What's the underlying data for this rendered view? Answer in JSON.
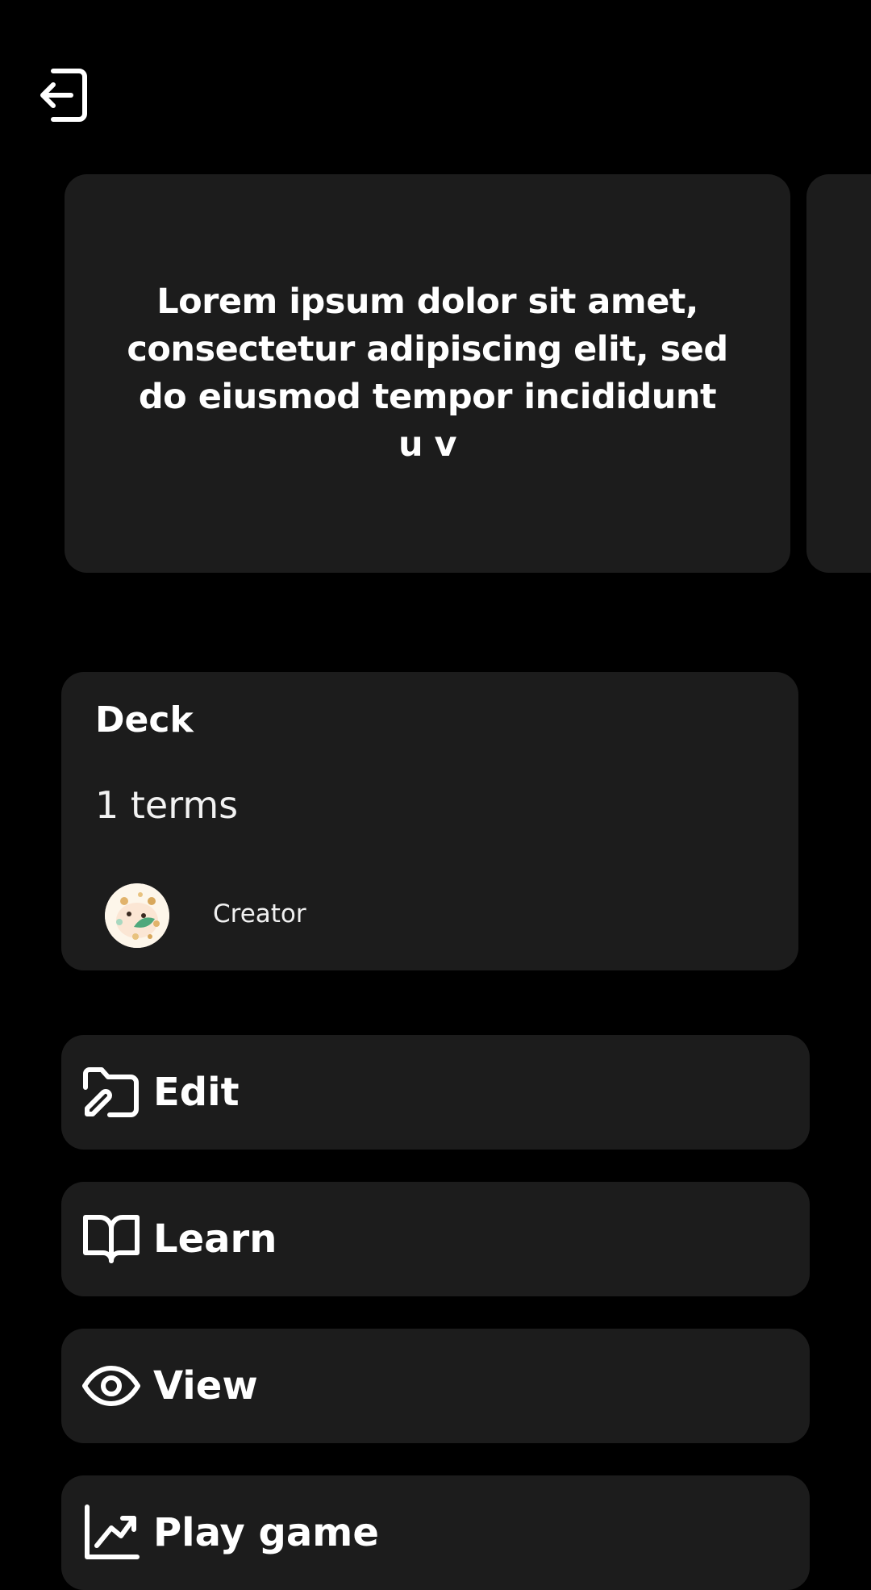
{
  "header": {
    "back_icon": "exit-arrow-icon"
  },
  "flashcard": {
    "front_text": "Lorem ipsum dolor sit amet, consectetur adipiscing elit, sed do eiusmod tempor incididunt u v"
  },
  "deck": {
    "title": "Deck",
    "terms": "1 terms",
    "creator_label": "Creator",
    "avatar_icon": "creator-avatar"
  },
  "actions": [
    {
      "label": "Edit",
      "icon": "folder-edit-icon"
    },
    {
      "label": "Learn",
      "icon": "open-book-icon"
    },
    {
      "label": "View",
      "icon": "eye-icon"
    },
    {
      "label": "Play game",
      "icon": "trend-chart-icon"
    }
  ],
  "colors": {
    "background": "#000000",
    "card": "#1c1c1c",
    "text": "#ffffff"
  }
}
